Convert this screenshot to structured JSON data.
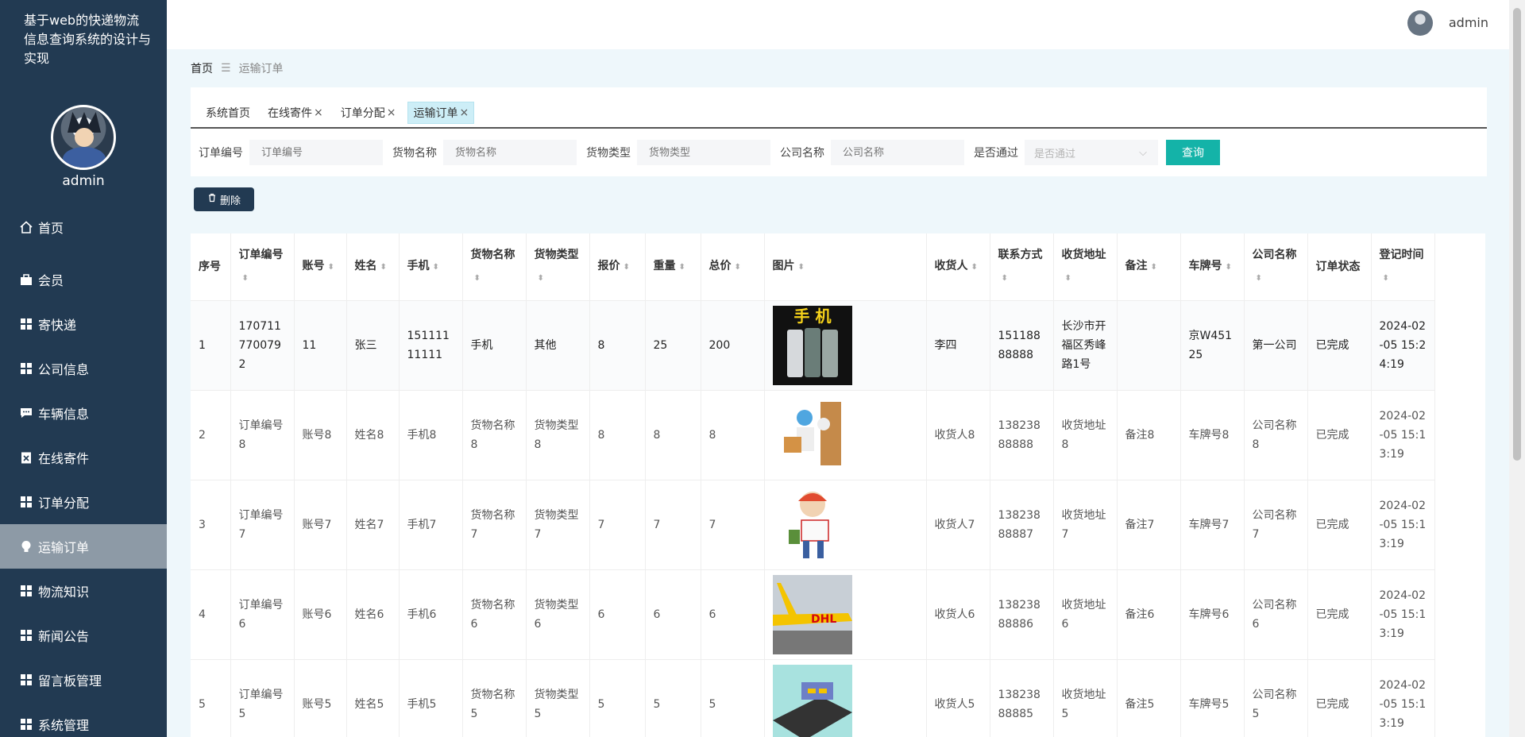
{
  "app": {
    "title": "基于web的快递物流信息查询系统的设计与实现",
    "user": "admin"
  },
  "sidebar": {
    "username": "admin",
    "items": [
      {
        "label": "首页",
        "icon": "home-icon"
      },
      {
        "label": "会员",
        "icon": "member-icon"
      },
      {
        "label": "寄快递",
        "icon": "grid-icon"
      },
      {
        "label": "公司信息",
        "icon": "grid-icon"
      },
      {
        "label": "车辆信息",
        "icon": "message-icon"
      },
      {
        "label": "在线寄件",
        "icon": "clipboard-icon"
      },
      {
        "label": "订单分配",
        "icon": "grid-icon"
      },
      {
        "label": "运输订单",
        "icon": "bulb-icon",
        "active": true
      },
      {
        "label": "物流知识",
        "icon": "grid-icon"
      },
      {
        "label": "新闻公告",
        "icon": "grid-icon"
      },
      {
        "label": "留言板管理",
        "icon": "grid-icon"
      },
      {
        "label": "系统管理",
        "icon": "grid-icon"
      }
    ]
  },
  "breadcrumb": {
    "home": "首页",
    "current": "运输订单"
  },
  "tabs": [
    {
      "label": "系统首页",
      "closable": false
    },
    {
      "label": "在线寄件",
      "closable": true
    },
    {
      "label": "订单分配",
      "closable": true
    },
    {
      "label": "运输订单",
      "closable": true,
      "active": true
    }
  ],
  "search": {
    "fields": [
      {
        "label": "订单编号",
        "placeholder": "订单编号"
      },
      {
        "label": "货物名称",
        "placeholder": "货物名称"
      },
      {
        "label": "货物类型",
        "placeholder": "货物类型"
      },
      {
        "label": "公司名称",
        "placeholder": "公司名称"
      }
    ],
    "select": {
      "label": "是否通过",
      "placeholder": "是否通过"
    },
    "query_button": "查询"
  },
  "delete_button": "删除",
  "table": {
    "columns": [
      "序号",
      "订单编号",
      "账号",
      "姓名",
      "手机",
      "货物名称",
      "货物类型",
      "报价",
      "重量",
      "总价",
      "图片",
      "收货人",
      "联系方式",
      "收货地址",
      "备注",
      "车牌号",
      "公司名称",
      "订单状态",
      "登记时间"
    ],
    "rows": [
      [
        "1",
        "1707117700792",
        "11",
        "张三",
        "15111111111",
        "手机",
        "其他",
        "8",
        "25",
        "200",
        "phone",
        "李四",
        "15118888888",
        "长沙市开福区秀峰路1号",
        "",
        "京W45125",
        "第一公司",
        "已完成",
        "2024-02-05 15:24:19"
      ],
      [
        "2",
        "订单编号8",
        "账号8",
        "姓名8",
        "手机8",
        "货物名称8",
        "货物类型8",
        "8",
        "8",
        "8",
        "delivery",
        "收货人8",
        "13823888888",
        "收货地址8",
        "备注8",
        "车牌号8",
        "公司名称8",
        "已完成",
        "2024-02-05 15:13:19"
      ],
      [
        "3",
        "订单编号7",
        "账号7",
        "姓名7",
        "手机7",
        "货物名称7",
        "货物类型7",
        "7",
        "7",
        "7",
        "courier",
        "收货人7",
        "13823888887",
        "收货地址7",
        "备注7",
        "车牌号7",
        "公司名称7",
        "已完成",
        "2024-02-05 15:13:19"
      ],
      [
        "4",
        "订单编号6",
        "账号6",
        "姓名6",
        "手机6",
        "货物名称6",
        "货物类型6",
        "6",
        "6",
        "6",
        "plane",
        "收货人6",
        "13823888886",
        "收货地址6",
        "备注6",
        "车牌号6",
        "公司名称6",
        "已完成",
        "2024-02-05 15:13:19"
      ],
      [
        "5",
        "订单编号5",
        "账号5",
        "姓名5",
        "手机5",
        "货物名称5",
        "货物类型5",
        "5",
        "5",
        "5",
        "truck",
        "收货人5",
        "13823888885",
        "收货地址5",
        "备注5",
        "车牌号5",
        "公司名称5",
        "已完成",
        "2024-02-05 15:13:19"
      ]
    ]
  },
  "colors": {
    "sidebar": "#223a52",
    "accent": "#14b3a8",
    "active_menu": "#8d9aa6"
  }
}
